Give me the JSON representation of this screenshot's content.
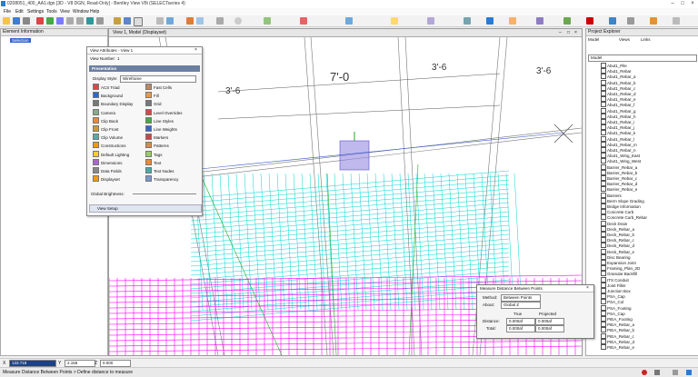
{
  "window": {
    "title": "0208051_400_AA1.dgn [3D - V8 DGN, Read-Only] - Bentley View V8i (SELECTseries 4)"
  },
  "menu": [
    "File",
    "Edit",
    "Settings",
    "Tools",
    "View",
    "Window",
    "Help"
  ],
  "element_info": {
    "title": "Element Information",
    "item": "Selection"
  },
  "view": {
    "title": "View 1, Model (Displayset)",
    "dims": [
      "3'-6",
      "7'-0",
      "3'-6",
      "3'-6"
    ]
  },
  "view_attributes": {
    "title": "View Attributes - View 1",
    "view_number_label": "View Number:",
    "view_number": "1",
    "presentation_label": "Presentation",
    "display_style_label": "Display Style:",
    "display_style": "Wireframe",
    "left_items": [
      "ACS Triad",
      "Background",
      "Boundary Display",
      "Camera",
      "Clip Back",
      "Clip Front",
      "Clip Volume",
      "Constructions",
      "Default Lighting",
      "Dimensions",
      "Data Fields",
      "Displayset"
    ],
    "right_items": [
      "Fast Cells",
      "Fill",
      "Grid",
      "Level Overrides",
      "Line Styles",
      "Line Weights",
      "Markers",
      "Patterns",
      "Tags",
      "Text",
      "Text Nodes",
      "Transparency"
    ],
    "global_brightness_label": "Global Brightness:",
    "view_setup_label": "View Setup"
  },
  "project_explorer": {
    "title": "Project Explorer",
    "tabs": [
      "Model",
      "Views",
      "Links"
    ],
    "model_select": "Model",
    "items": [
      "Abut1_Pile",
      "Abut1_Rebar",
      "Abut1_Rebar_a",
      "Abut1_Rebar_b",
      "Abut1_Rebar_c",
      "Abut1_Rebar_d",
      "Abut1_Rebar_e",
      "Abut1_Rebar_f",
      "Abut1_Rebar_g",
      "Abut1_Rebar_h",
      "Abut1_Rebar_i",
      "Abut1_Rebar_j",
      "Abut1_Rebar_k",
      "Abut1_Rebar_l",
      "Abut1_Rebar_m",
      "Abut1_Rebar_n",
      "Abut1_Wing_East",
      "Abut1_Wing_West",
      "Barrier_Rebar_a",
      "Barrier_Rebar_b",
      "Barrier_Rebar_c",
      "Barrier_Rebar_d",
      "Barrier_Rebar_e",
      "Barriers",
      "Berm Slope Grading",
      "Bridge Information",
      "Concrete Curb",
      "Concrete Curb_Rebar",
      "Deck Drain",
      "Deck_Rebar_a",
      "Deck_Rebar_b",
      "Deck_Rebar_c",
      "Deck_Rebar_d",
      "Deck_Rebar_e",
      "Disc Bearing",
      "Expansion Joint",
      "Framing_Plan_2D",
      "Granular Backfill",
      "ITS Conduit",
      "Joint Filler",
      "Junction Box",
      "PSA_Cap",
      "PSA_Col",
      "PSA_Footing",
      "PSA_Cap",
      "PIEA_Footing",
      "PIEA_Rebar_a",
      "PIEA_Rebar_b",
      "PIEA_Rebar_c",
      "PIEA_Rebar_d",
      "PIEA_Rebar_e",
      "PIEA_Rebar_f",
      "PIEA_Rebar_g",
      "PIEA_Rebar_h",
      "PIEA_Rebar_i",
      "PTA_Cap",
      "PTA_Footing"
    ]
  },
  "measure_dialog": {
    "title": "Measure Distance Between Points",
    "method_label": "Method:",
    "method": "Between Points",
    "about_label": "About:",
    "about": "Global Z",
    "col_true": "True",
    "col_projected": "Projected",
    "distance_label": "Distance:",
    "distance_true": "0.000af",
    "distance_projected": "0.000af",
    "total_label": "Total:",
    "total_true": "0.000af",
    "total_projected": "0.000af"
  },
  "coords": {
    "x_label": "X",
    "x": "133.718",
    "y_label": "Y",
    "y": "2.156",
    "z_label": "Z",
    "z": "0.000"
  },
  "status": {
    "text": "Measure Distance Between Points > Define distance to measure"
  },
  "colors": {
    "cyan": "#00e5e5",
    "magenta": "#ff00ff",
    "green": "#22bb22",
    "blue": "#2255cc"
  }
}
